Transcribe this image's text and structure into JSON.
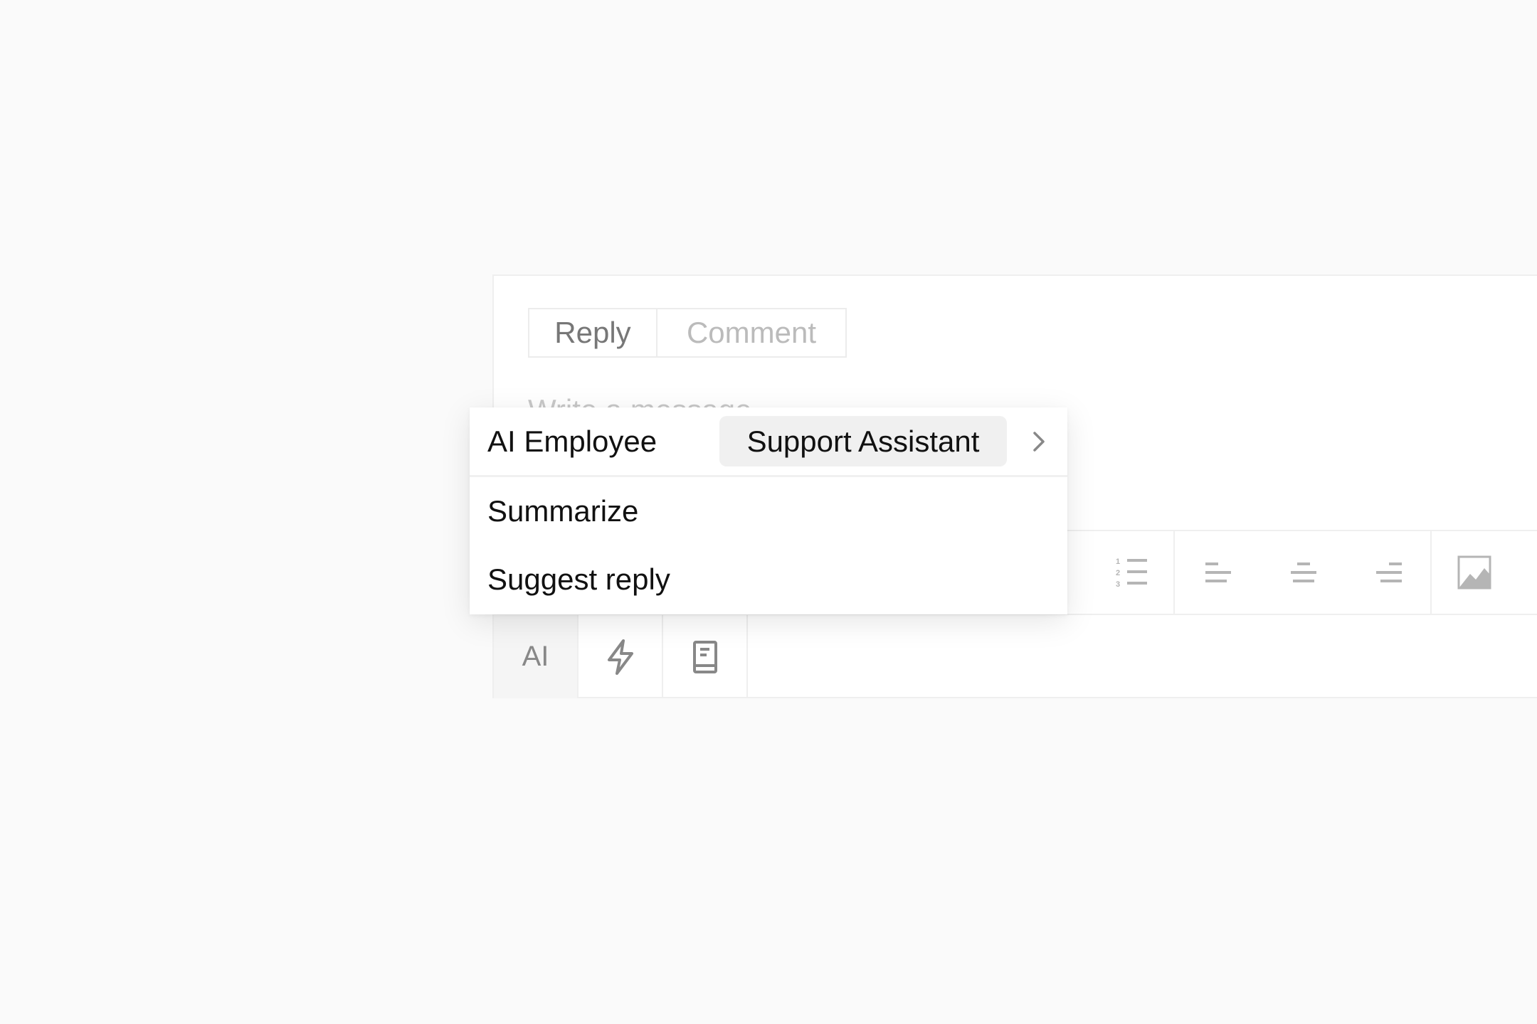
{
  "composer": {
    "tabs": [
      {
        "label": "Reply",
        "active": true
      },
      {
        "label": "Comment",
        "active": false
      }
    ],
    "placeholder": "Write a message",
    "toolbar_icons": [
      "ordered-list-icon",
      "align-left-icon",
      "align-center-icon",
      "align-right-icon",
      "image-icon"
    ],
    "bottom_toolbar": {
      "ai_label": "AI",
      "icons": [
        "lightning-icon",
        "book-icon"
      ]
    }
  },
  "ai_menu": {
    "employee_label": "AI Employee",
    "employee_value": "Support Assistant",
    "items": [
      {
        "label": "Summarize"
      },
      {
        "label": "Suggest reply"
      }
    ]
  },
  "colors": {
    "icon": "#b5b5b5",
    "text": "#111111",
    "chip_bg": "#f0f0f0"
  }
}
